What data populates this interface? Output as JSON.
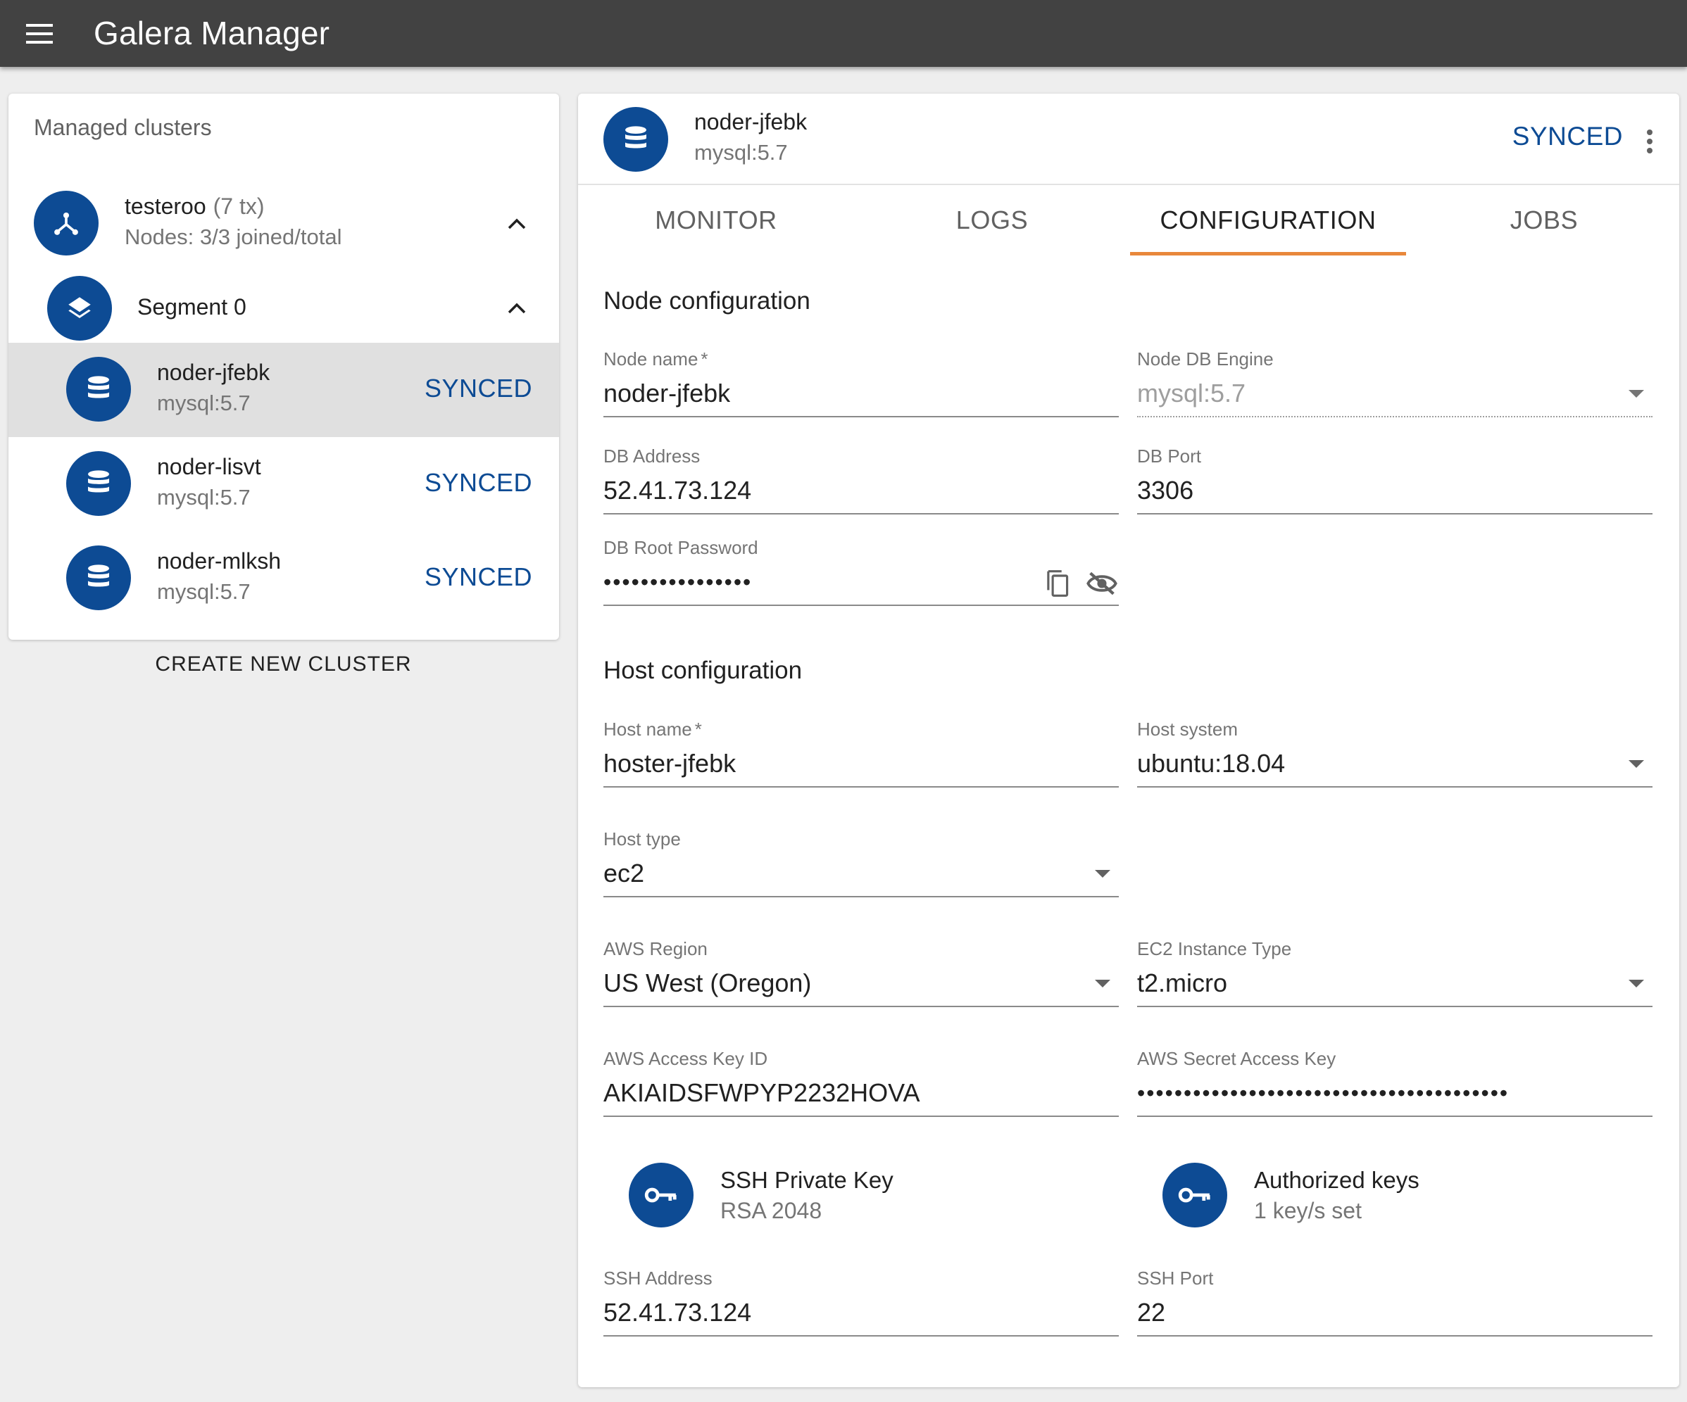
{
  "app": {
    "title": "Galera Manager"
  },
  "sidebar": {
    "heading": "Managed clusters",
    "cluster": {
      "name": "testeroo",
      "tx": "(7 tx)",
      "nodes_info": "Nodes: 3/3 joined/total"
    },
    "segment": {
      "name": "Segment 0"
    },
    "nodes": [
      {
        "name": "noder-jfebk",
        "engine": "mysql:5.7",
        "status": "SYNCED",
        "selected": true
      },
      {
        "name": "noder-lisvt",
        "engine": "mysql:5.7",
        "status": "SYNCED",
        "selected": false
      },
      {
        "name": "noder-mlksh",
        "engine": "mysql:5.7",
        "status": "SYNCED",
        "selected": false
      }
    ],
    "create_button": "CREATE NEW CLUSTER"
  },
  "detail": {
    "node_name": "noder-jfebk",
    "engine": "mysql:5.7",
    "status": "SYNCED",
    "tabs": [
      {
        "label": "MONITOR",
        "active": false
      },
      {
        "label": "LOGS",
        "active": false
      },
      {
        "label": "CONFIGURATION",
        "active": true
      },
      {
        "label": "JOBS",
        "active": false
      }
    ]
  },
  "node_config": {
    "title": "Node configuration",
    "node_name": {
      "label": "Node name",
      "required": "*",
      "value": "noder-jfebk"
    },
    "db_engine": {
      "label": "Node DB Engine",
      "value": "mysql:5.7"
    },
    "db_address": {
      "label": "DB Address",
      "value": "52.41.73.124"
    },
    "db_port": {
      "label": "DB Port",
      "value": "3306"
    },
    "db_root_password": {
      "label": "DB Root Password",
      "value": "••••••••••••••••"
    }
  },
  "host_config": {
    "title": "Host configuration",
    "host_name": {
      "label": "Host name",
      "required": "*",
      "value": "hoster-jfebk"
    },
    "host_system": {
      "label": "Host system",
      "value": "ubuntu:18.04"
    },
    "host_type": {
      "label": "Host type",
      "value": "ec2"
    },
    "aws_region": {
      "label": "AWS Region",
      "value": "US West (Oregon)"
    },
    "ec2_instance_type": {
      "label": "EC2 Instance Type",
      "value": "t2.micro"
    },
    "aws_access_key_id": {
      "label": "AWS Access Key ID",
      "value": "AKIAIDSFWPYP2232HOVA"
    },
    "aws_secret_access_key": {
      "label": "AWS Secret Access Key",
      "value": "••••••••••••••••••••••••••••••••••••••••"
    },
    "ssh_private_key": {
      "title": "SSH Private Key",
      "subtitle": "RSA 2048"
    },
    "authorized_keys": {
      "title": "Authorized keys",
      "subtitle": "1 key/s set"
    },
    "ssh_address": {
      "label": "SSH Address",
      "value": "52.41.73.124"
    },
    "ssh_port": {
      "label": "SSH Port",
      "value": "22"
    }
  },
  "icons": {
    "menu": "menu-icon",
    "cluster": "hub-icon",
    "segment": "layers-icon",
    "node": "database-icon",
    "collapse": "chevron-up-icon",
    "more": "more-vert-icon",
    "copy": "copy-icon",
    "visibility": "visibility-off-icon",
    "dropdown": "arrow-drop-down-icon",
    "key": "key-icon"
  },
  "colors": {
    "primary": "#0d4b94",
    "appbar": "#424242",
    "tab_indicator": "#e8873b",
    "selected_row": "#e0e0e0"
  }
}
